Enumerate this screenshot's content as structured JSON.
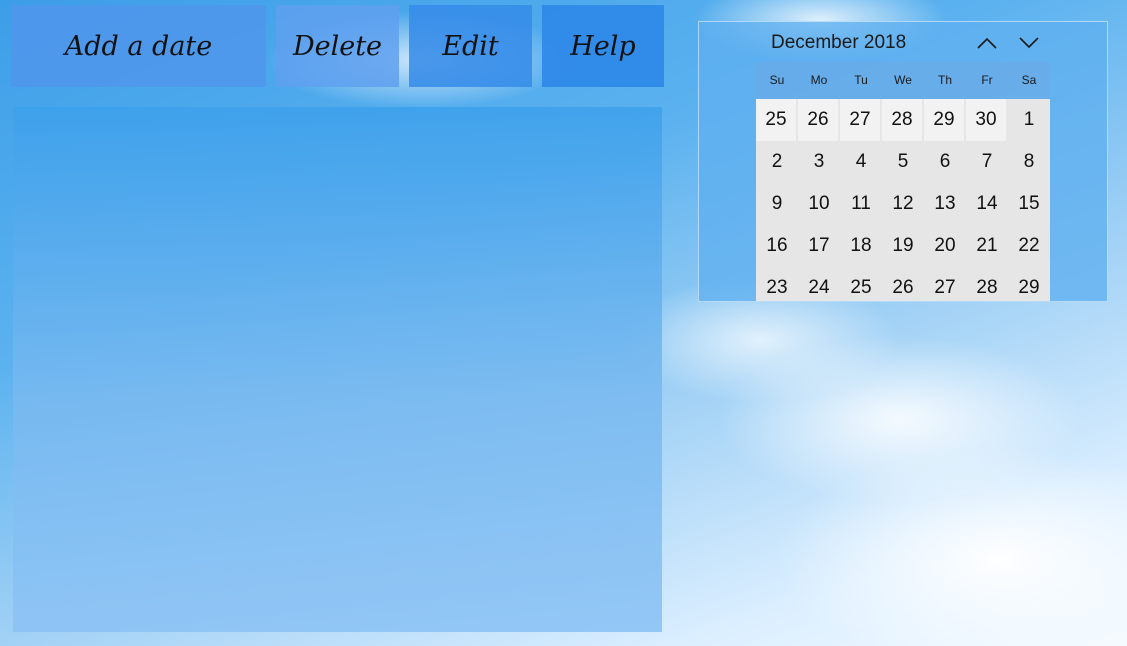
{
  "toolbar": {
    "add_label": "Add a date",
    "delete_label": "Delete",
    "edit_label": "Edit",
    "help_label": "Help"
  },
  "calendar": {
    "month_label": "December 2018",
    "nav_up_icon": "chevron-up-icon",
    "nav_down_icon": "chevron-down-icon",
    "weekdays": [
      "Su",
      "Mo",
      "Tu",
      "We",
      "Th",
      "Fr",
      "Sa"
    ],
    "days": [
      {
        "n": "25",
        "other": true
      },
      {
        "n": "26",
        "other": true
      },
      {
        "n": "27",
        "other": true
      },
      {
        "n": "28",
        "other": true
      },
      {
        "n": "29",
        "other": true
      },
      {
        "n": "30",
        "other": true
      },
      {
        "n": "1",
        "other": false
      },
      {
        "n": "2",
        "other": false
      },
      {
        "n": "3",
        "other": false
      },
      {
        "n": "4",
        "other": false
      },
      {
        "n": "5",
        "other": false
      },
      {
        "n": "6",
        "other": false
      },
      {
        "n": "7",
        "other": false
      },
      {
        "n": "8",
        "other": false
      },
      {
        "n": "9",
        "other": false
      },
      {
        "n": "10",
        "other": false
      },
      {
        "n": "11",
        "other": false
      },
      {
        "n": "12",
        "other": false
      },
      {
        "n": "13",
        "other": false
      },
      {
        "n": "14",
        "other": false
      },
      {
        "n": "15",
        "other": false
      },
      {
        "n": "16",
        "other": false
      },
      {
        "n": "17",
        "other": false
      },
      {
        "n": "18",
        "other": false
      },
      {
        "n": "19",
        "other": false
      },
      {
        "n": "20",
        "other": false
      },
      {
        "n": "21",
        "other": false
      },
      {
        "n": "22",
        "other": false
      },
      {
        "n": "23",
        "other": false
      },
      {
        "n": "24",
        "other": false
      },
      {
        "n": "25",
        "other": false
      },
      {
        "n": "26",
        "other": false
      },
      {
        "n": "27",
        "other": false
      },
      {
        "n": "28",
        "other": false
      },
      {
        "n": "29",
        "other": false
      }
    ]
  }
}
